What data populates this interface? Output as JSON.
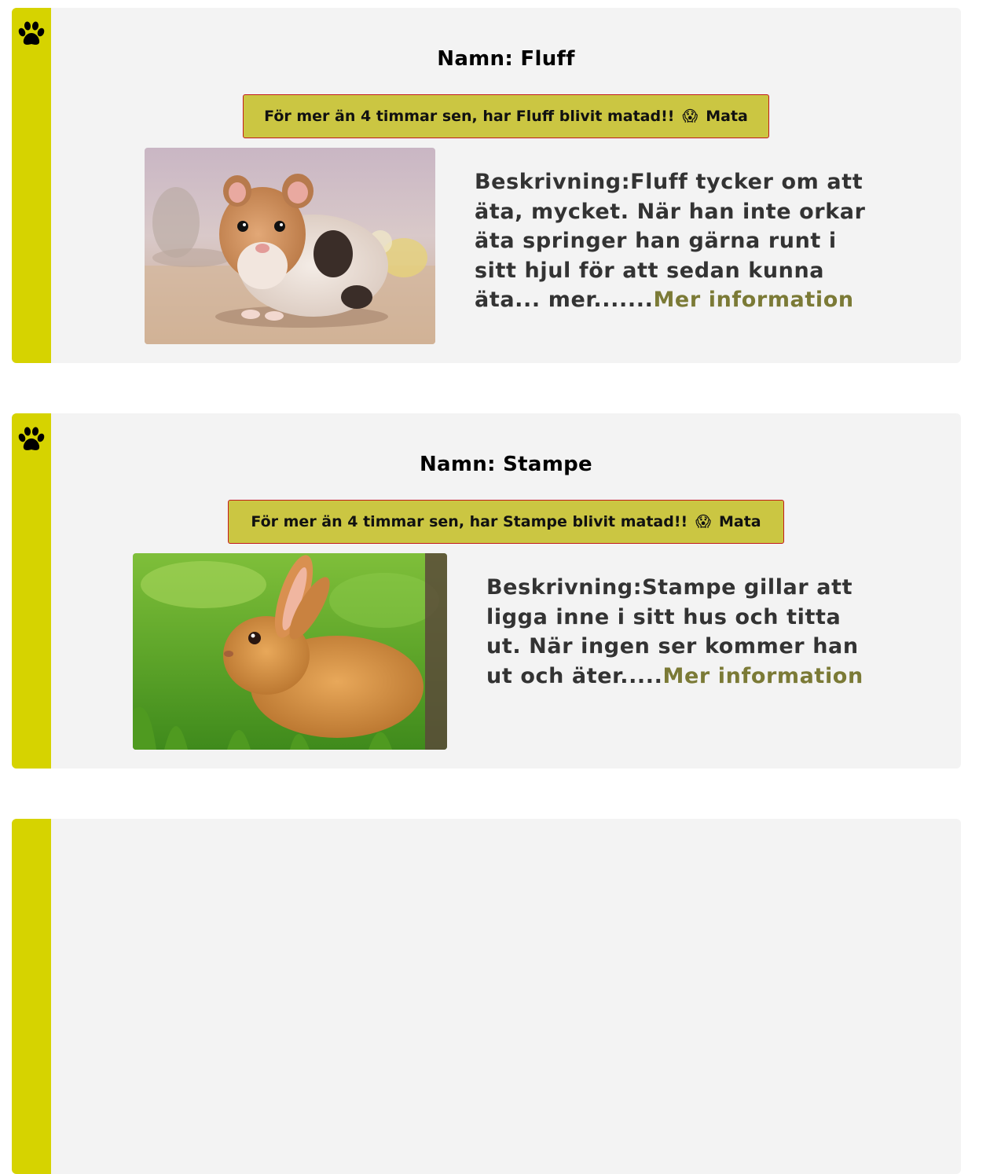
{
  "pets": [
    {
      "name_label": "Namn: Fluff",
      "feed_text": "För mer än 4 timmar sen, har Fluff blivit matad!!",
      "feed_emoji": "😱",
      "feed_action": "Mata",
      "photo": "hamster",
      "description": "Beskrivning:Fluff tycker om att äta, mycket. När han inte orkar äta springer han gärna runt i sitt hjul för att sedan kunna äta... mer.......",
      "more_link": "Mer information"
    },
    {
      "name_label": "Namn: Stampe",
      "feed_text": "För mer än 4 timmar sen, har Stampe blivit matad!!",
      "feed_emoji": "😱",
      "feed_action": "Mata",
      "photo": "rabbit",
      "description": "Beskrivning:Stampe gillar att ligga inne i sitt hus och titta ut. När ingen ser kommer han ut och äter.....",
      "more_link": "Mer information"
    }
  ],
  "colors": {
    "stripe": "#d6d300",
    "card_bg": "#f3f3f3",
    "feed_bg": "#cbc642",
    "feed_border": "#c21b1b",
    "link": "#7b7a36"
  },
  "icons": {
    "card_icon": "paw-icon"
  }
}
